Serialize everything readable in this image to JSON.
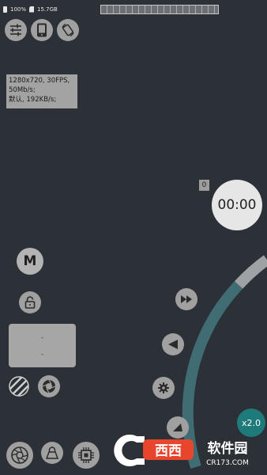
{
  "status": {
    "battery": "100%",
    "storage": "15.7GB"
  },
  "info": {
    "line1": "1280x720, 30FPS,",
    "line2": "50Mb/s;",
    "line3": "默认, 192KB/s;"
  },
  "recording": {
    "counter": "0",
    "timer": "00:00"
  },
  "mode": {
    "label": "M"
  },
  "panel": {
    "value_top": "-",
    "value_bottom": "-"
  },
  "zoom": {
    "label": "x2.0"
  },
  "watermark": {
    "brand": "西西",
    "text": "软件园",
    "domain": "CR173.COM"
  },
  "icons": {
    "settings": "sliders-icon",
    "phone": "phone-icon",
    "rotate": "rotate-icon",
    "lock": "lock-icon",
    "fast_forward": "fast-forward-icon",
    "prev": "triangle-left-icon",
    "gear": "gear-icon",
    "up": "triangle-up-icon",
    "stripes": "stripes-icon",
    "aperture": "aperture-icon",
    "cpu": "cpu-icon"
  },
  "colors": {
    "background": "#2c3138",
    "accent": "#1f7a7a",
    "arc": "#3f6d73"
  }
}
